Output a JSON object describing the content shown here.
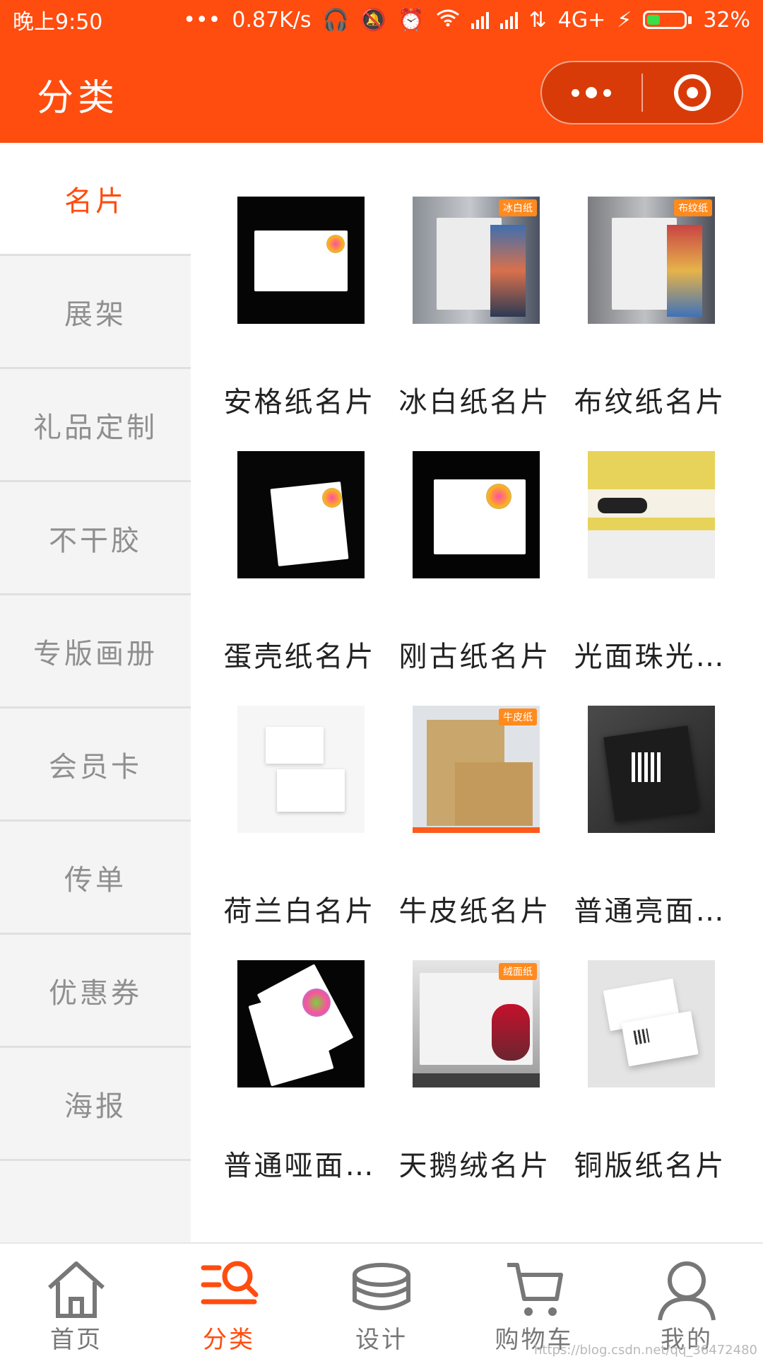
{
  "status_bar": {
    "time": "晚上9:50",
    "dots": "•••",
    "speed": "0.87K/s",
    "network": "4G+",
    "battery": "32%"
  },
  "header": {
    "title": "分类"
  },
  "sidebar": {
    "items": [
      {
        "label": "名片",
        "active": true
      },
      {
        "label": "展架",
        "active": false
      },
      {
        "label": "礼品定制",
        "active": false
      },
      {
        "label": "不干胶",
        "active": false
      },
      {
        "label": "专版画册",
        "active": false
      },
      {
        "label": "会员卡",
        "active": false
      },
      {
        "label": "传单",
        "active": false
      },
      {
        "label": "优惠券",
        "active": false
      },
      {
        "label": "海报",
        "active": false
      }
    ]
  },
  "products": [
    {
      "name": "安格纸名片",
      "tag": ""
    },
    {
      "name": "冰白纸名片",
      "tag": "冰白纸"
    },
    {
      "name": "布纹纸名片",
      "tag": "布纹纸"
    },
    {
      "name": "蛋壳纸名片",
      "tag": ""
    },
    {
      "name": "刚古纸名片",
      "tag": ""
    },
    {
      "name": "光面珠光…",
      "tag": ""
    },
    {
      "name": "荷兰白名片",
      "tag": ""
    },
    {
      "name": "牛皮纸名片",
      "tag": "牛皮纸"
    },
    {
      "name": "普通亮面…",
      "tag": ""
    },
    {
      "name": "普通哑面…",
      "tag": ""
    },
    {
      "name": "天鹅绒名片",
      "tag": "绒面纸"
    },
    {
      "name": "铜版纸名片",
      "tag": ""
    }
  ],
  "tabbar": {
    "items": [
      {
        "label": "首页",
        "icon": "home-icon"
      },
      {
        "label": "分类",
        "icon": "category-search-icon"
      },
      {
        "label": "设计",
        "icon": "layers-icon"
      },
      {
        "label": "购物车",
        "icon": "cart-icon"
      },
      {
        "label": "我的",
        "icon": "user-icon"
      }
    ]
  },
  "watermark": "https://blog.csdn.net/qq_36472480",
  "colors": {
    "brand": "#ff4c0f",
    "sidebar_bg": "#f4f4f4",
    "inactive_text": "#8f8f8f"
  }
}
